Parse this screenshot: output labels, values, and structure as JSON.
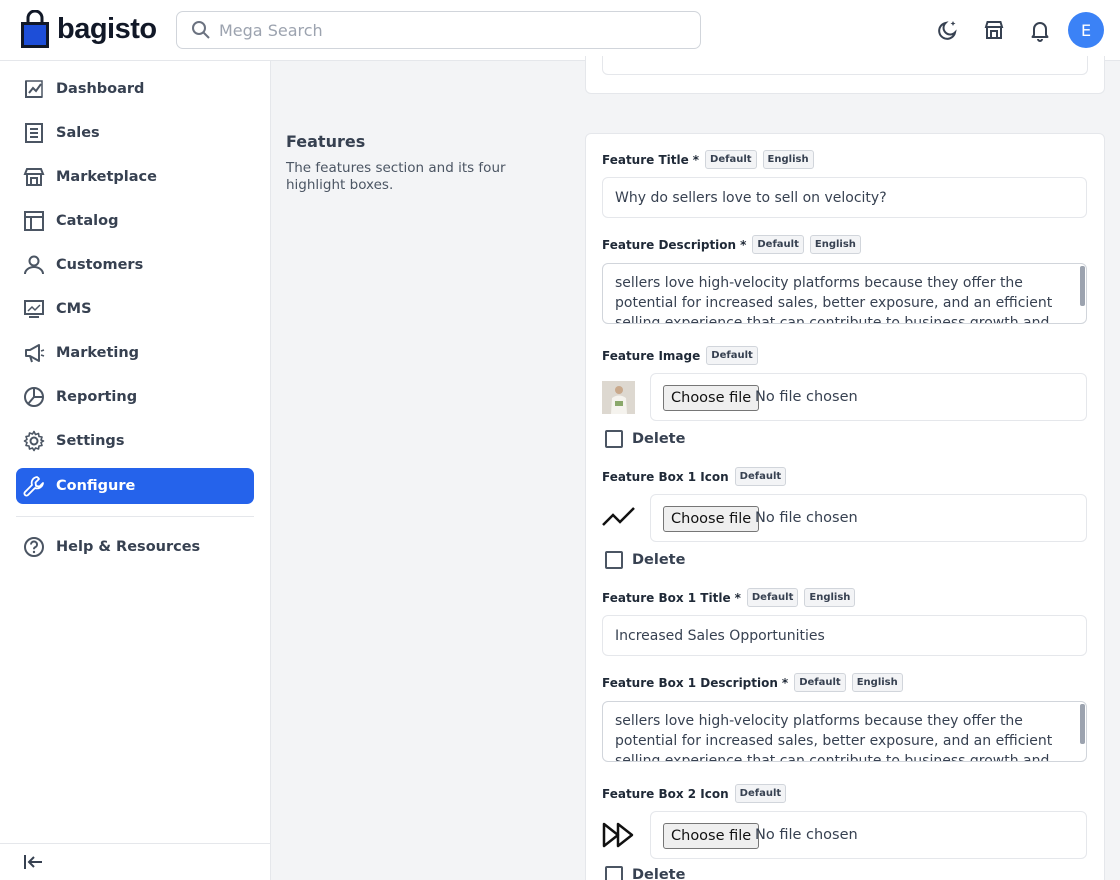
{
  "header": {
    "logo_text": "bagisto",
    "search_placeholder": "Mega Search",
    "avatar_initial": "E",
    "brand_color": "#2563eb"
  },
  "sidebar": {
    "items": [
      {
        "label": "Dashboard",
        "icon": "dashboard-icon"
      },
      {
        "label": "Sales",
        "icon": "receipt-icon"
      },
      {
        "label": "Marketplace",
        "icon": "store-icon"
      },
      {
        "label": "Catalog",
        "icon": "catalog-icon"
      },
      {
        "label": "Customers",
        "icon": "user-icon"
      },
      {
        "label": "CMS",
        "icon": "monitor-icon"
      },
      {
        "label": "Marketing",
        "icon": "megaphone-icon"
      },
      {
        "label": "Reporting",
        "icon": "pie-chart-icon"
      },
      {
        "label": "Settings",
        "icon": "gear-icon"
      },
      {
        "label": "Configure",
        "icon": "wrench-icon",
        "active": true
      }
    ],
    "help_label": "Help & Resources"
  },
  "section": {
    "title": "Features",
    "description": "The features section and its four highlight boxes."
  },
  "badges": {
    "default": "Default",
    "english": "English"
  },
  "fields": {
    "feature_title": {
      "label": "Feature Title",
      "required": "*",
      "value": "Why do sellers love to sell on velocity?"
    },
    "feature_description": {
      "label": "Feature Description",
      "required": "*",
      "value": "sellers love high-velocity platforms because they offer the potential for increased sales, better exposure, and an efficient selling experience that can contribute to business growth and success."
    },
    "feature_image": {
      "label": "Feature Image",
      "button": "Choose file",
      "status": "No file chosen",
      "delete_label": "Delete"
    },
    "box1_icon": {
      "label": "Feature Box 1 Icon",
      "button": "Choose file",
      "status": "No file chosen",
      "delete_label": "Delete"
    },
    "box1_title": {
      "label": "Feature Box 1 Title",
      "required": "*",
      "value": "Increased Sales Opportunities"
    },
    "box1_description": {
      "label": "Feature Box 1 Description",
      "required": "*",
      "value": "sellers love high-velocity platforms because they offer the potential for increased sales, better exposure, and an efficient selling experience that can contribute to business growth and success."
    },
    "box2_icon": {
      "label": "Feature Box 2 Icon",
      "button": "Choose file",
      "status": "No file chosen",
      "delete_label": "Delete"
    }
  }
}
